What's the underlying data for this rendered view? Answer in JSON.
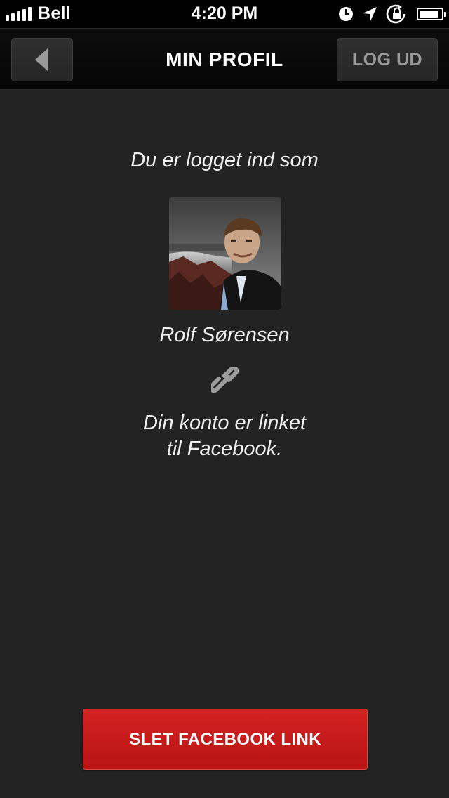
{
  "status_bar": {
    "carrier": "Bell",
    "time": "4:20 PM",
    "signal_bars": 5,
    "battery_level": 0.85,
    "icons": [
      "alarm-icon",
      "location-arrow-icon",
      "rotation-lock-icon",
      "battery-icon"
    ]
  },
  "nav": {
    "back_icon": "back-arrow-icon",
    "title": "MIN PROFIL",
    "logout_label": "LOG UD"
  },
  "profile": {
    "logged_in_text": "Du er logget ind som",
    "name": "Rolf Sørensen",
    "link_icon": "chain-link-icon",
    "linked_line1": "Din konto er linket",
    "linked_line2": "til Facebook."
  },
  "actions": {
    "delete_link_label": "SLET FACEBOOK LINK"
  },
  "colors": {
    "background": "#232323",
    "nav_background": "#080808",
    "accent_red": "#c81a1a",
    "button_grey": "#2b2b2b"
  }
}
